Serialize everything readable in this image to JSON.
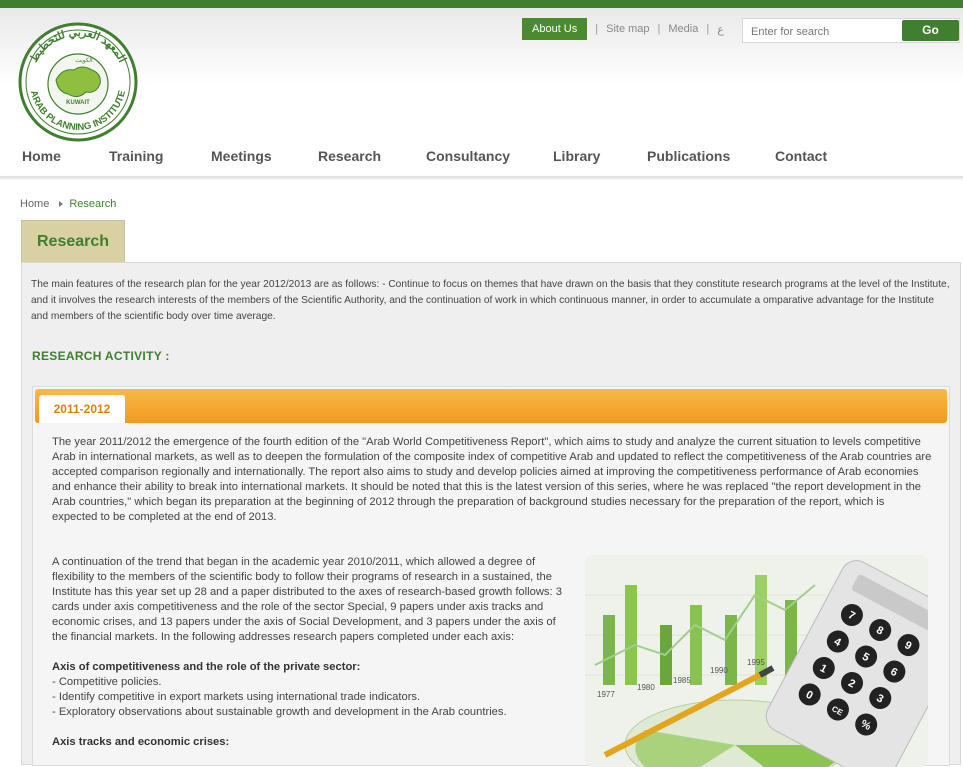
{
  "header": {
    "logo_text_arabic": "المعهد العربي للتخطيط",
    "logo_text_kuwait_ar": "الكويت",
    "logo_text_kuwait": "KUWAIT",
    "logo_text_english": "ARAB PLANNING INSTITUTE",
    "top_links": [
      "About Us",
      "Site map",
      "Media",
      "ع"
    ],
    "separator": "|",
    "search_placeholder": "Enter for search",
    "search_button": "Go"
  },
  "nav": [
    "Home",
    "Training",
    "Meetings",
    "Research",
    "Consultancy",
    "Library",
    "Publications",
    "Contact"
  ],
  "breadcrumb": {
    "home": "Home",
    "current": "Research"
  },
  "page_tab": "Research",
  "intro": "The main features of the research plan for the year 2012/2013 are as follows: - Continue to focus on themes that have drawn on the basis that they constitute research programs at the level of the Institute, and it involves the research interests of the members of the Scientific Authority, and the continuation of work in which continuous manner, in order to accumulate a omparative advantage for the Institute and members of the scientific body over time average.",
  "research_activity_title": "RESEARCH ACTIVITY :",
  "year_tab": "2011-2012",
  "para1": "The year 2011/2012 the emergence of the fourth edition of the \"Arab World Competitiveness Report\", which aims to study and analyze the current situation to levels competitive Arab in international markets, as well as to deepen the formulation of the composite index of competitive Arab and updated to reflect the competitiveness of the Arab countries are accepted comparison regionally and internationally. The report also aims to study and develop policies aimed at improving the competitiveness performance of Arab economies and enhance their ability to break into international markets. It should be noted that this is the latest version of this series, where he was replaced \"the report development in the Arab countries,\" which began its preparation at the beginning of 2012 through the preparation of background studies necessary for the preparation of the report, which is expected to be completed at the end of 2013.",
  "para2": "A continuation of the trend that began in the academic year 2010/2011, which allowed a degree of flexibility to the members of the scientific body to follow their programs of research in a sustained, the Institute has this year set up 28 and a paper distributed to the axes of research-based growth follows: 3 cards under axis competitiveness and the role of the sector Special, 9 papers under axis tracks and economic crises, and 13 papers under the axis of Social Development, and 3 papers under the axis of the financial markets. In the following addresses research papers completed under each axis:",
  "axis1": {
    "title": "Axis of competitiveness and the role of the private sector:",
    "items": [
      "- Competitive policies.",
      "- Identify competitive in export markets using international trade indicators.",
      "- Exploratory observations about sustainable growth and development in the Arab countries."
    ]
  },
  "axis2_title": "Axis tracks and economic crises:",
  "photo": {
    "year_labels": [
      "1977",
      "1980",
      "1985",
      "1990",
      "1995"
    ],
    "calculator_keys": [
      "7",
      "8",
      "9",
      "4",
      "5",
      "6",
      "1",
      "2",
      "3",
      "0",
      "CE",
      "%"
    ]
  },
  "colors": {
    "brand_green": "#3f7f2f",
    "orange": "#f19a1c",
    "tab_beige": "#d9d0a4"
  }
}
